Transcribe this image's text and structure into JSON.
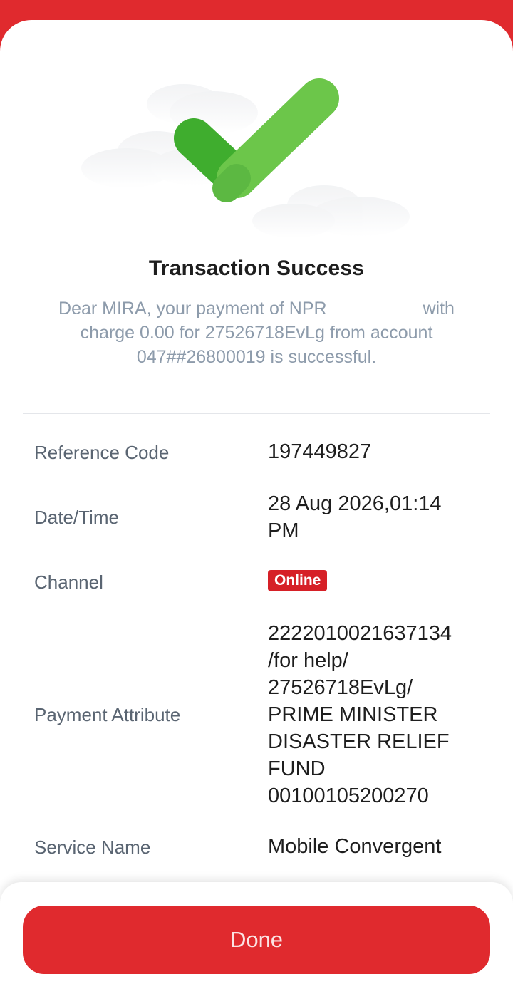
{
  "colors": {
    "brand": "#e02a2e",
    "badge": "#d62027",
    "success_green": "#5cc443",
    "message_text": "#8d9bab",
    "label_text": "#5a6572"
  },
  "hero": {
    "icon": "success-checkmark-icon"
  },
  "status": {
    "title": "Transaction Success",
    "message_line1_before": "Dear MIRA, your payment of NPR",
    "message_line1_after": "with",
    "message_line2": "charge 0.00 for 27526718EvLg from account",
    "message_line3": "047##26800019 is successful."
  },
  "details": {
    "reference_code": {
      "label": "Reference Code",
      "value": "197449827"
    },
    "date_time": {
      "label": "Date/Time",
      "value_lines": [
        "28 Aug 2026,01:14",
        "PM"
      ]
    },
    "channel": {
      "label": "Channel",
      "value": "Online"
    },
    "payment_attribute": {
      "label": "Payment Attribute",
      "value_lines": [
        "2222010021637134",
        "/for help/",
        "27526718EvLg/",
        "PRIME MINISTER",
        "DISASTER RELIEF",
        "FUND",
        "00100105200270"
      ]
    },
    "service_name": {
      "label": "Service Name",
      "value": "Mobile Convergent"
    }
  },
  "footer": {
    "done_label": "Done"
  }
}
